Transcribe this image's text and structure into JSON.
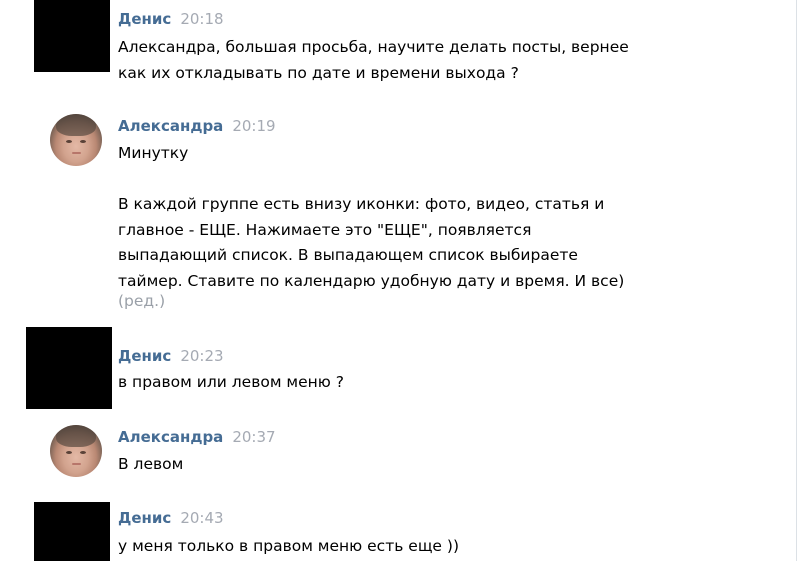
{
  "messages": [
    {
      "author": "Денис",
      "time": "20:18",
      "text": "Александра, большая просьба, научите делать посты, вернее\nкак их откладывать по дате и времени выхода ?"
    },
    {
      "author": "Александра",
      "time": "20:19",
      "text": "Минутку\n\nВ каждой группе есть внизу иконки: фото, видео, статья и\nглавное - ЕЩЕ. Нажимаете это \"ЕЩЕ\", появляется\nвыпадающий список. В выпадающем список выбираете\nтаймер. Ставите по календарю удобную дату и время. И все)",
      "edited": "(ред.)"
    },
    {
      "author": "Денис",
      "time": "20:23",
      "text": "в правом или левом меню ?"
    },
    {
      "author": "Александра",
      "time": "20:37",
      "text": "В левом"
    },
    {
      "author": "Денис",
      "time": "20:43",
      "text": "у меня только в правом меню есть еще ))"
    }
  ]
}
